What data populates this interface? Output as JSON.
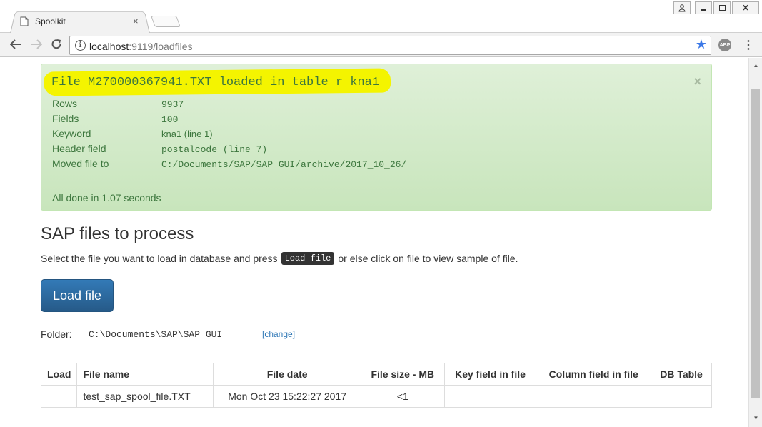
{
  "browser": {
    "tab_title": "Spoolkit",
    "tab_close": "×",
    "url_host": "localhost",
    "url_rest": ":9119/loadfiles",
    "abp_label": "ABP",
    "icons": {
      "back": "arrow-left",
      "forward": "arrow-right",
      "reload": "reload",
      "info": "info",
      "star": "star",
      "menu": "kebab-menu"
    },
    "window_controls": {
      "user": "user",
      "minimize": "minimize",
      "restore": "restore",
      "close": "close"
    }
  },
  "alert": {
    "title": "File M270000367941.TXT loaded in table r_kna1",
    "close": "×",
    "rows": [
      {
        "label": "Rows",
        "value": "9937"
      },
      {
        "label": "Fields",
        "value": "100"
      },
      {
        "label": "Keyword",
        "value": "kna1 (line 1)"
      },
      {
        "label": "Header field",
        "value": "postalcode (line 7)"
      },
      {
        "label": "Moved file to",
        "value": "C:/Documents/SAP/SAP GUI/archive/2017_10_26/"
      }
    ],
    "done": "All done in 1.07 seconds"
  },
  "main": {
    "heading": "SAP files to process",
    "intro_before": "Select the file you want to load in database and press",
    "intro_kbd": "Load file",
    "intro_after": "or else click on file to view sample of file.",
    "load_button": "Load file",
    "folder_label": "Folder:",
    "folder_path": "C:\\Documents\\SAP\\SAP GUI",
    "folder_change": "[change]"
  },
  "table": {
    "headers": [
      "Load",
      "File name",
      "File date",
      "File size - MB",
      "Key field in file",
      "Column field in file",
      "DB Table"
    ],
    "rows": [
      {
        "load": "",
        "file_name": "test_sap_spool_file.TXT",
        "file_date": "Mon Oct 23 15:22:27 2017",
        "file_size": "<1",
        "key_field": "",
        "column_field": "",
        "db_table": ""
      }
    ]
  },
  "colors": {
    "alert_bg": "#dff0d8",
    "alert_text": "#3c763d",
    "highlight": "#f4f400",
    "primary": "#337ab7",
    "link": "#337ab7"
  }
}
